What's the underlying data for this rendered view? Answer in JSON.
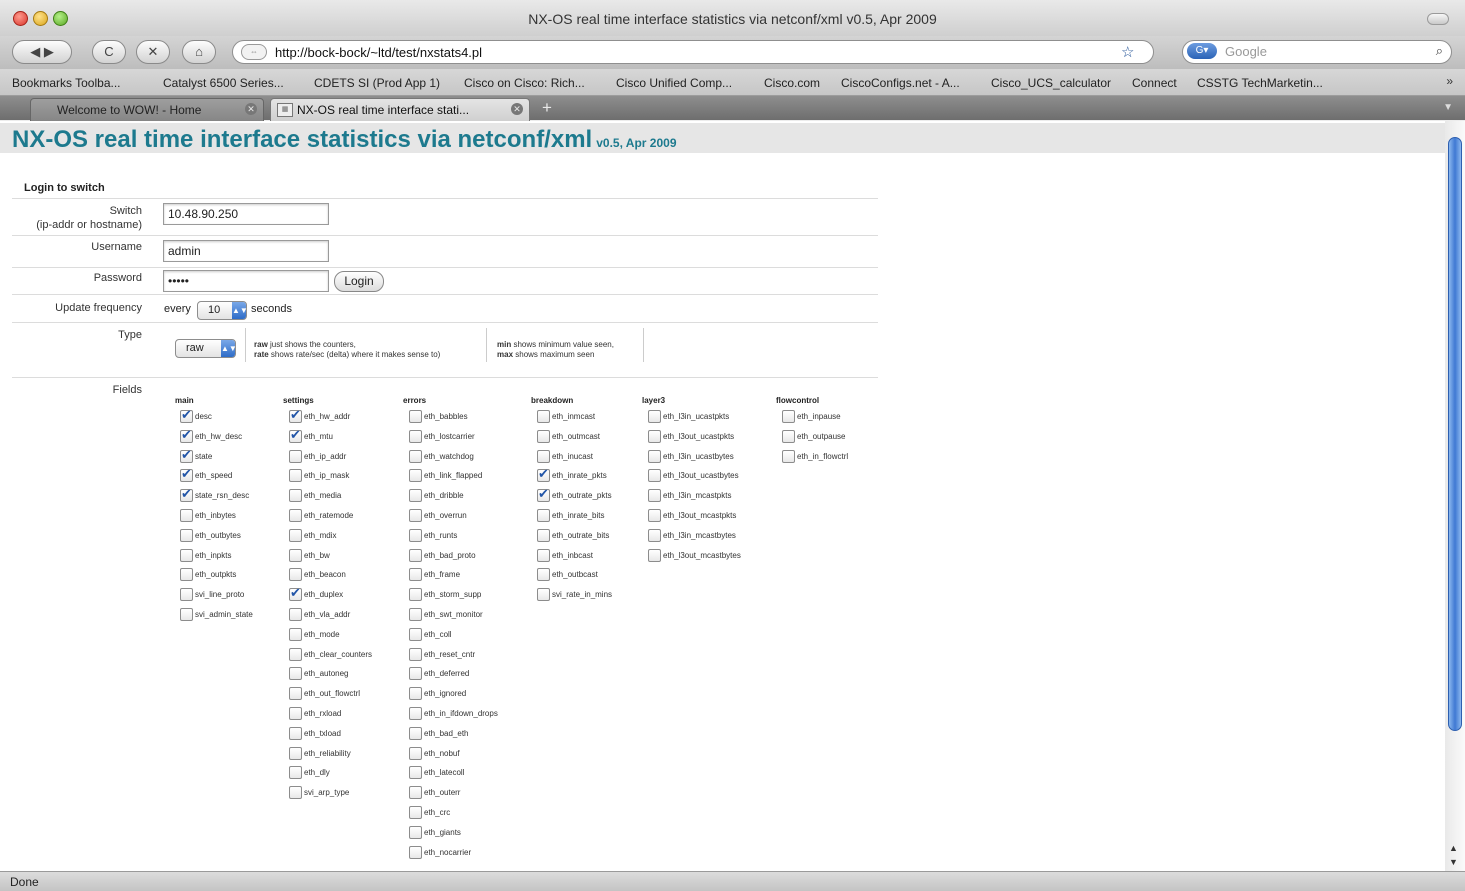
{
  "window": {
    "title": "NX-OS real time interface statistics via netconf/xml v0.5, Apr 2009"
  },
  "toolbar": {
    "back_label": "◀",
    "forward_label": "▶",
    "reload_label": "C",
    "stop_label": "✕",
    "home_label": "⌂",
    "url": "http://bock-bock/~ltd/test/nxstats4.pl",
    "search_placeholder": "Google"
  },
  "bookmarks": [
    "Bookmarks Toolba...",
    "Catalyst 6500 Series...",
    "CDETS SI (Prod App 1)",
    "Cisco on Cisco: Rich...",
    "Cisco Unified Comp...",
    "Cisco.com",
    "CiscoConfigs.net - A...",
    "Cisco_UCS_calculator",
    "Connect",
    "CSSTG TechMarketin..."
  ],
  "tabs": [
    {
      "label": "Welcome to WOW! - Home",
      "active": false
    },
    {
      "label": "NX-OS real time interface stati...",
      "active": true
    }
  ],
  "page": {
    "title": "NX-OS real time interface statistics via netconf/xml",
    "version": "v0.5, Apr 2009",
    "login_section": "Login to switch",
    "switch_label_1": "Switch",
    "switch_label_2": "(ip-addr or hostname)",
    "switch_value": "10.48.90.250",
    "username_label": "Username",
    "username_value": "admin",
    "password_label": "Password",
    "password_value": "•••••",
    "login_button": "Login",
    "update_label": "Update frequency",
    "every_text": "every",
    "frequency_value": "10",
    "seconds_text": "seconds",
    "type_label": "Type",
    "type_value": "raw",
    "help_raw_key": "raw",
    "help_raw_text": "just shows the counters,",
    "help_rate_key": "rate",
    "help_rate_text": "shows rate/sec (delta) where it makes sense to)",
    "help_min_key": "min",
    "help_min_text": "shows minimum value seen,",
    "help_max_key": "max",
    "help_max_text": "shows maximum seen",
    "fields_label": "Fields"
  },
  "field_columns": [
    {
      "name": "main",
      "items": [
        {
          "label": "desc",
          "checked": true
        },
        {
          "label": "eth_hw_desc",
          "checked": true
        },
        {
          "label": "state",
          "checked": true
        },
        {
          "label": "eth_speed",
          "checked": true
        },
        {
          "label": "state_rsn_desc",
          "checked": true
        },
        {
          "label": "eth_inbytes",
          "checked": false
        },
        {
          "label": "eth_outbytes",
          "checked": false
        },
        {
          "label": "eth_inpkts",
          "checked": false
        },
        {
          "label": "eth_outpkts",
          "checked": false
        },
        {
          "label": "svi_line_proto",
          "checked": false
        },
        {
          "label": "svi_admin_state",
          "checked": false
        }
      ]
    },
    {
      "name": "settings",
      "items": [
        {
          "label": "eth_hw_addr",
          "checked": true
        },
        {
          "label": "eth_mtu",
          "checked": true
        },
        {
          "label": "eth_ip_addr",
          "checked": false
        },
        {
          "label": "eth_ip_mask",
          "checked": false
        },
        {
          "label": "eth_media",
          "checked": false
        },
        {
          "label": "eth_ratemode",
          "checked": false
        },
        {
          "label": "eth_mdix",
          "checked": false
        },
        {
          "label": "eth_bw",
          "checked": false
        },
        {
          "label": "eth_beacon",
          "checked": false
        },
        {
          "label": "eth_duplex",
          "checked": true
        },
        {
          "label": "eth_vla_addr",
          "checked": false
        },
        {
          "label": "eth_mode",
          "checked": false
        },
        {
          "label": "eth_clear_counters",
          "checked": false
        },
        {
          "label": "eth_autoneg",
          "checked": false
        },
        {
          "label": "eth_out_flowctrl",
          "checked": false
        },
        {
          "label": "eth_rxload",
          "checked": false
        },
        {
          "label": "eth_txload",
          "checked": false
        },
        {
          "label": "eth_reliability",
          "checked": false
        },
        {
          "label": "eth_dly",
          "checked": false
        },
        {
          "label": "svi_arp_type",
          "checked": false
        }
      ]
    },
    {
      "name": "errors",
      "items": [
        {
          "label": "eth_babbles",
          "checked": false
        },
        {
          "label": "eth_lostcarrier",
          "checked": false
        },
        {
          "label": "eth_watchdog",
          "checked": false
        },
        {
          "label": "eth_link_flapped",
          "checked": false
        },
        {
          "label": "eth_dribble",
          "checked": false
        },
        {
          "label": "eth_overrun",
          "checked": false
        },
        {
          "label": "eth_runts",
          "checked": false
        },
        {
          "label": "eth_bad_proto",
          "checked": false
        },
        {
          "label": "eth_frame",
          "checked": false
        },
        {
          "label": "eth_storm_supp",
          "checked": false
        },
        {
          "label": "eth_swt_monitor",
          "checked": false
        },
        {
          "label": "eth_coll",
          "checked": false
        },
        {
          "label": "eth_reset_cntr",
          "checked": false
        },
        {
          "label": "eth_deferred",
          "checked": false
        },
        {
          "label": "eth_ignored",
          "checked": false
        },
        {
          "label": "eth_in_ifdown_drops",
          "checked": false
        },
        {
          "label": "eth_bad_eth",
          "checked": false
        },
        {
          "label": "eth_nobuf",
          "checked": false
        },
        {
          "label": "eth_latecoll",
          "checked": false
        },
        {
          "label": "eth_outerr",
          "checked": false
        },
        {
          "label": "eth_crc",
          "checked": false
        },
        {
          "label": "eth_giants",
          "checked": false
        },
        {
          "label": "eth_nocarrier",
          "checked": false
        }
      ]
    },
    {
      "name": "breakdown",
      "items": [
        {
          "label": "eth_inmcast",
          "checked": false
        },
        {
          "label": "eth_outmcast",
          "checked": false
        },
        {
          "label": "eth_inucast",
          "checked": false
        },
        {
          "label": "eth_inrate_pkts",
          "checked": true
        },
        {
          "label": "eth_outrate_pkts",
          "checked": true
        },
        {
          "label": "eth_inrate_bits",
          "checked": false
        },
        {
          "label": "eth_outrate_bits",
          "checked": false
        },
        {
          "label": "eth_inbcast",
          "checked": false
        },
        {
          "label": "eth_outbcast",
          "checked": false
        },
        {
          "label": "svi_rate_in_mins",
          "checked": false
        }
      ]
    },
    {
      "name": "layer3",
      "items": [
        {
          "label": "eth_l3in_ucastpkts",
          "checked": false
        },
        {
          "label": "eth_l3out_ucastpkts",
          "checked": false
        },
        {
          "label": "eth_l3in_ucastbytes",
          "checked": false
        },
        {
          "label": "eth_l3out_ucastbytes",
          "checked": false
        },
        {
          "label": "eth_l3in_mcastpkts",
          "checked": false
        },
        {
          "label": "eth_l3out_mcastpkts",
          "checked": false
        },
        {
          "label": "eth_l3in_mcastbytes",
          "checked": false
        },
        {
          "label": "eth_l3out_mcastbytes",
          "checked": false
        }
      ]
    },
    {
      "name": "flowcontrol",
      "items": [
        {
          "label": "eth_inpause",
          "checked": false
        },
        {
          "label": "eth_outpause",
          "checked": false
        },
        {
          "label": "eth_in_flowctrl",
          "checked": false
        }
      ]
    }
  ],
  "status": {
    "text": "Done"
  }
}
